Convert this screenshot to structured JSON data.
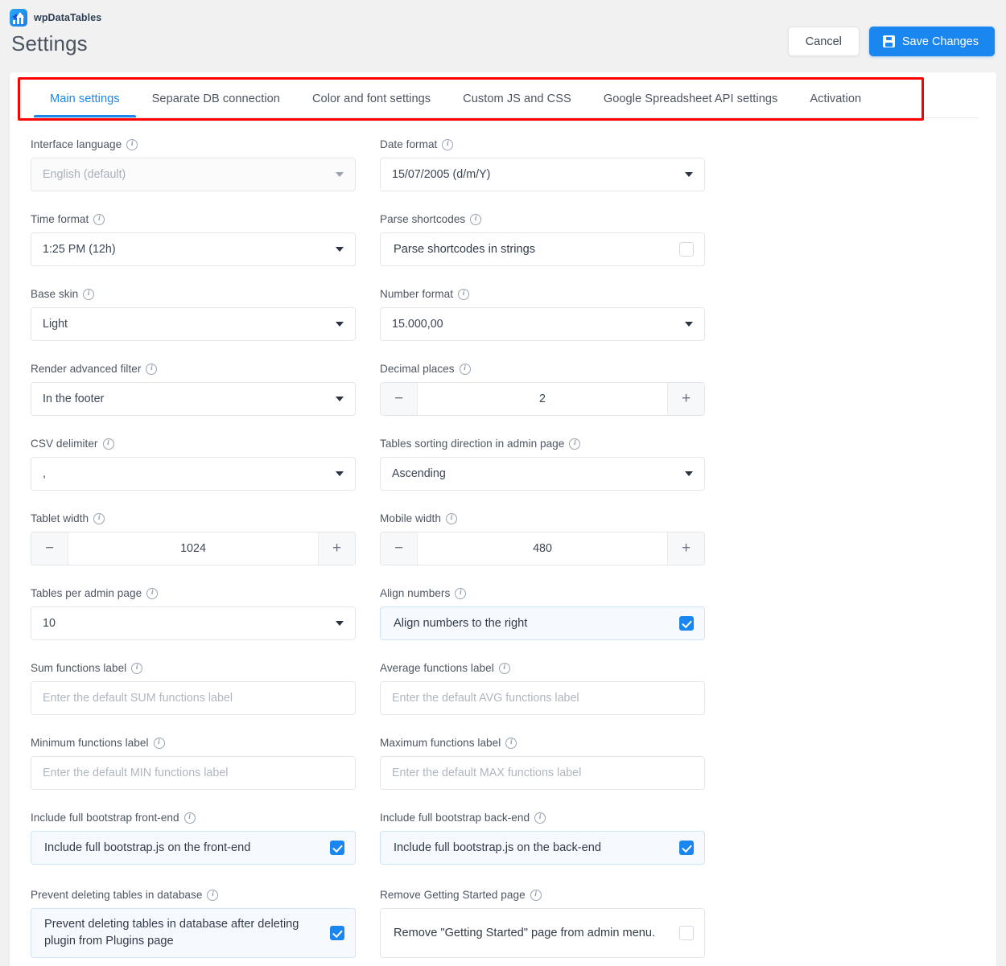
{
  "header": {
    "brand_name": "wpDataTables",
    "page_title": "Settings",
    "cancel_label": "Cancel",
    "save_label": "Save Changes",
    "accent_color": "#1a86f0",
    "highlight_color": "#ff0000"
  },
  "tabs": [
    {
      "label": "Main settings",
      "active": true
    },
    {
      "label": "Separate DB connection",
      "active": false
    },
    {
      "label": "Color and font settings",
      "active": false
    },
    {
      "label": "Custom JS and CSS",
      "active": false
    },
    {
      "label": "Google Spreadsheet API settings",
      "active": false
    },
    {
      "label": "Activation",
      "active": false
    }
  ],
  "fields": {
    "interface_language": {
      "label": "Interface language",
      "value": "English (default)"
    },
    "date_format": {
      "label": "Date format",
      "value": "15/07/2005 (d/m/Y)"
    },
    "time_format": {
      "label": "Time format",
      "value": "1:25 PM (12h)"
    },
    "parse_shortcodes": {
      "label": "Parse shortcodes",
      "text": "Parse shortcodes in strings",
      "checked": false
    },
    "base_skin": {
      "label": "Base skin",
      "value": "Light"
    },
    "number_format": {
      "label": "Number format",
      "value": "15.000,00"
    },
    "render_advanced_filter": {
      "label": "Render advanced filter",
      "value": "In the footer"
    },
    "decimal_places": {
      "label": "Decimal places",
      "value": "2",
      "minus": "−",
      "plus": "+"
    },
    "csv_delimiter": {
      "label": "CSV delimiter",
      "value": ","
    },
    "tables_sorting": {
      "label": "Tables sorting direction in admin page",
      "value": "Ascending"
    },
    "tablet_width": {
      "label": "Tablet width",
      "value": "1024",
      "minus": "−",
      "plus": "+"
    },
    "mobile_width": {
      "label": "Mobile width",
      "value": "480",
      "minus": "−",
      "plus": "+"
    },
    "tables_per_page": {
      "label": "Tables per admin page",
      "value": "10"
    },
    "align_numbers": {
      "label": "Align numbers",
      "text": "Align numbers to the right",
      "checked": true
    },
    "sum_label": {
      "label": "Sum functions label",
      "placeholder": "Enter the default SUM functions label",
      "value": ""
    },
    "avg_label": {
      "label": "Average functions label",
      "placeholder": "Enter the default AVG functions label",
      "value": ""
    },
    "min_label": {
      "label": "Minimum functions label",
      "placeholder": "Enter the default MIN functions label",
      "value": ""
    },
    "max_label": {
      "label": "Maximum functions label",
      "placeholder": "Enter the default MAX functions label",
      "value": ""
    },
    "bootstrap_front": {
      "label": "Include full bootstrap front-end",
      "text": "Include full bootstrap.js on the front-end",
      "checked": true
    },
    "bootstrap_back": {
      "label": "Include full bootstrap back-end",
      "text": "Include full bootstrap.js on the back-end",
      "checked": true
    },
    "prevent_delete": {
      "label": "Prevent deleting tables in database",
      "text": "Prevent deleting tables in database after deleting plugin from Plugins page",
      "checked": true
    },
    "remove_getting_started": {
      "label": "Remove Getting Started page",
      "text": "Remove \"Getting Started\" page from admin menu.",
      "checked": false
    }
  },
  "info_glyph": "i"
}
